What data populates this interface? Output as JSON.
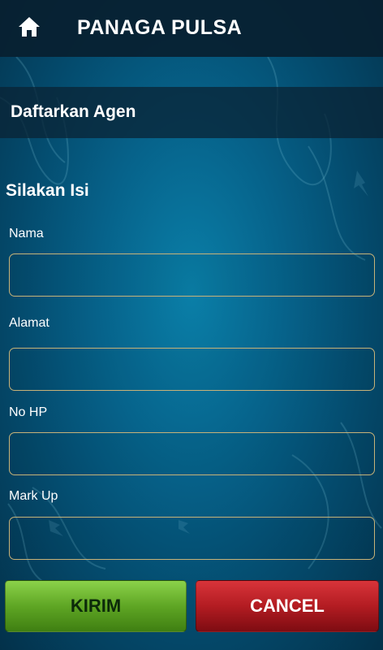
{
  "header": {
    "home_icon": "home-icon",
    "title": "PANAGA PULSA"
  },
  "section": {
    "title": "Daftarkan Agen"
  },
  "form": {
    "heading": "Silakan Isi",
    "fields": [
      {
        "label": "Nama",
        "value": "",
        "placeholder": ""
      },
      {
        "label": "Alamat",
        "value": "",
        "placeholder": ""
      },
      {
        "label": "No HP",
        "value": "",
        "placeholder": ""
      },
      {
        "label": "Mark Up",
        "value": "",
        "placeholder": ""
      }
    ]
  },
  "buttons": {
    "submit_label": "KIRIM",
    "cancel_label": "CANCEL"
  },
  "colors": {
    "background": "#06628a",
    "input_border": "#c8b278",
    "submit": "#5fa624",
    "cancel": "#b31c22"
  }
}
